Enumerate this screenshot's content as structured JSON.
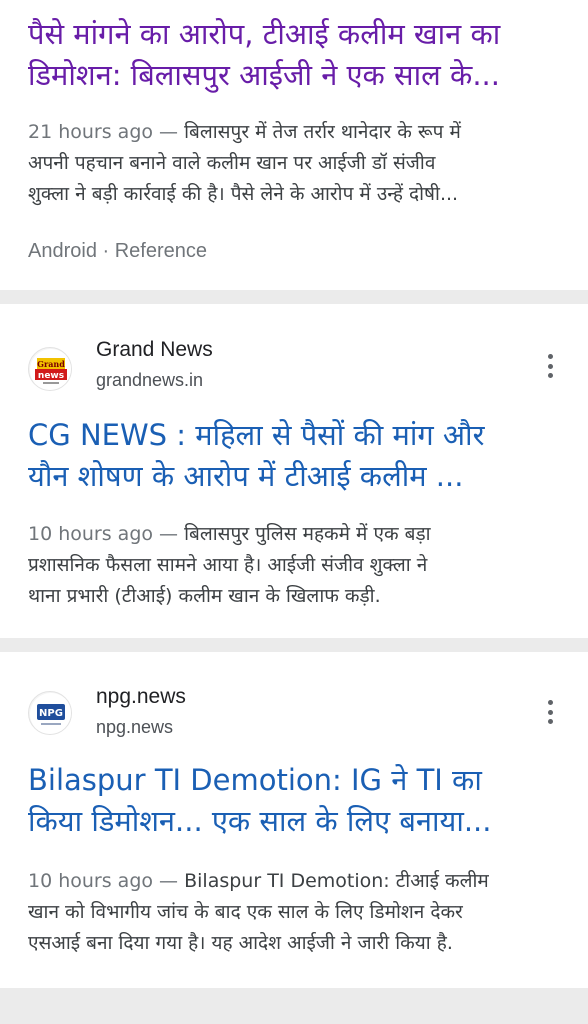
{
  "results": [
    {
      "title_lines": [
        "पैसे मांगने का आरोप, टीआई कलीम खान का",
        "डिमोशन: बिलासपुर आईजी ने एक साल के..."
      ],
      "time": "21 hours ago",
      "separator": " — ",
      "snippet_lines": [
        "बिलासपुर में तेज तर्रार थानेदार के रूप में",
        "अपनी पहचान बनाने वाले कलीम खान पर आईजी डॉ संजीव",
        "शुक्ला ने बड़ी कार्रवाई की है। पैसे लेने के आरोप में उन्हें दोषी..."
      ],
      "meta": "Android · Reference"
    },
    {
      "source_name": "Grand News",
      "source_url": "grandnews.in",
      "favicon_text": [
        "Grand",
        "news"
      ],
      "favicon_color": "#d11a1a",
      "title_lines": [
        "CG NEWS : महिला से पैसों की मांग और",
        "यौन शोषण के आरोप में टीआई कलीम ..."
      ],
      "time": "10 hours ago",
      "separator": " — ",
      "snippet_lines": [
        "बिलासपुर पुलिस महकमे में एक बड़ा",
        "प्रशासनिक फैसला सामने आया है। आईजी संजीव शुक्ला ने",
        "थाना प्रभारी (टीआई) कलीम खान के खिलाफ कड़ी."
      ]
    },
    {
      "source_name": "npg.news",
      "source_url": "npg.news",
      "favicon_text": [
        "NPG"
      ],
      "favicon_color": "#1f4e9c",
      "title_lines": [
        "Bilaspur TI Demotion: IG ने TI का",
        "किया डिमोशन... एक साल के लिए बनाया..."
      ],
      "time": "10 hours ago",
      "separator": " — ",
      "snippet_lines": [
        "Bilaspur TI Demotion: टीआई कलीम",
        "खान को विभागीय जांच के बाद एक साल के लिए डिमोशन देकर",
        "एसआई बना दिया गया है। यह आदेश आईजी ने जारी किया है."
      ]
    }
  ],
  "colors": {
    "visited_title": "#681da8",
    "link_title": "#1a5fb4",
    "background": "#ebebeb"
  }
}
